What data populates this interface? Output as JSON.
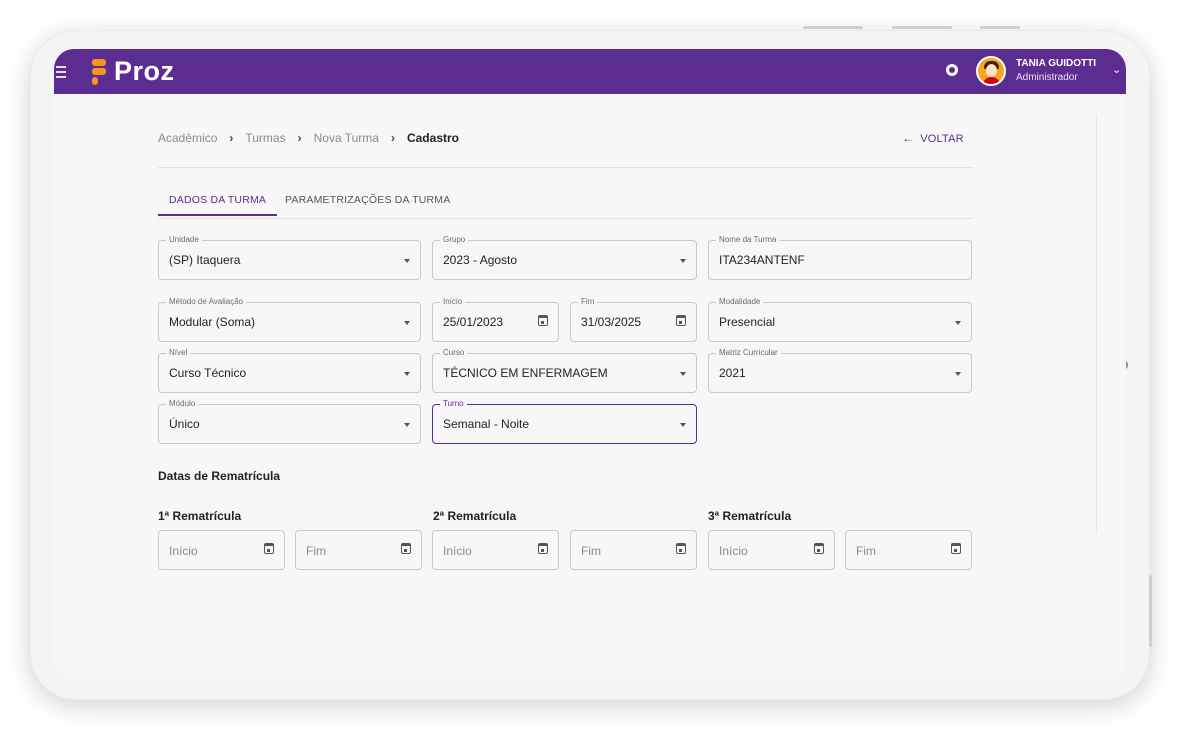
{
  "header": {
    "brand": "Proz",
    "user_name": "TANIA GUIDOTTI",
    "user_role": "Administrador",
    "menu_icon": "hamburger-icon",
    "bell_icon": "notification-icon",
    "chevron_icon": "chevron-down-icon",
    "color": "#5c2d91",
    "logo_color": "#f7941d"
  },
  "breadcrumb": [
    "Acadêmico",
    "Turmas",
    "Nova Turma",
    "Cadastro"
  ],
  "back_label": "VOLTAR",
  "tabs": [
    {
      "label": "DADOS DA TURMA",
      "active": true
    },
    {
      "label": "PARAMETRIZAÇÕES DA TURMA",
      "active": false
    }
  ],
  "fields": {
    "unidade": {
      "label": "Unidade",
      "value": "(SP) Itaquera"
    },
    "grupo": {
      "label": "Grupo",
      "value": "2023 - Agosto"
    },
    "nome_turma": {
      "label": "Nome da Turma",
      "value": "ITA234ANTENF"
    },
    "metodo": {
      "label": "Método de Avaliação",
      "value": "Modular (Soma)"
    },
    "inicio": {
      "label": "Início",
      "value": "25/01/2023"
    },
    "fim": {
      "label": "Fim",
      "value": "31/03/2025"
    },
    "modalidade": {
      "label": "Modalidade",
      "value": "Presencial"
    },
    "nivel": {
      "label": "Nível",
      "value": "Curso Técnico"
    },
    "curso": {
      "label": "Curso",
      "value": "TÉCNICO EM ENFERMAGEM"
    },
    "matriz": {
      "label": "Matriz Curricular",
      "value": "2021"
    },
    "modulo": {
      "label": "Módulo",
      "value": "Único"
    },
    "turno": {
      "label": "Turno",
      "value": "Semanal - Noite"
    }
  },
  "rematricula": {
    "title": "Datas de Rematrícula",
    "groups": [
      {
        "title": "1ª Rematrícula",
        "inicio_placeholder": "Início",
        "fim_placeholder": "Fim"
      },
      {
        "title": "2ª Rematrícula",
        "inicio_placeholder": "Início",
        "fim_placeholder": "Fim"
      },
      {
        "title": "3ª Rematrícula",
        "inicio_placeholder": "Início",
        "fim_placeholder": "Fim"
      }
    ]
  }
}
